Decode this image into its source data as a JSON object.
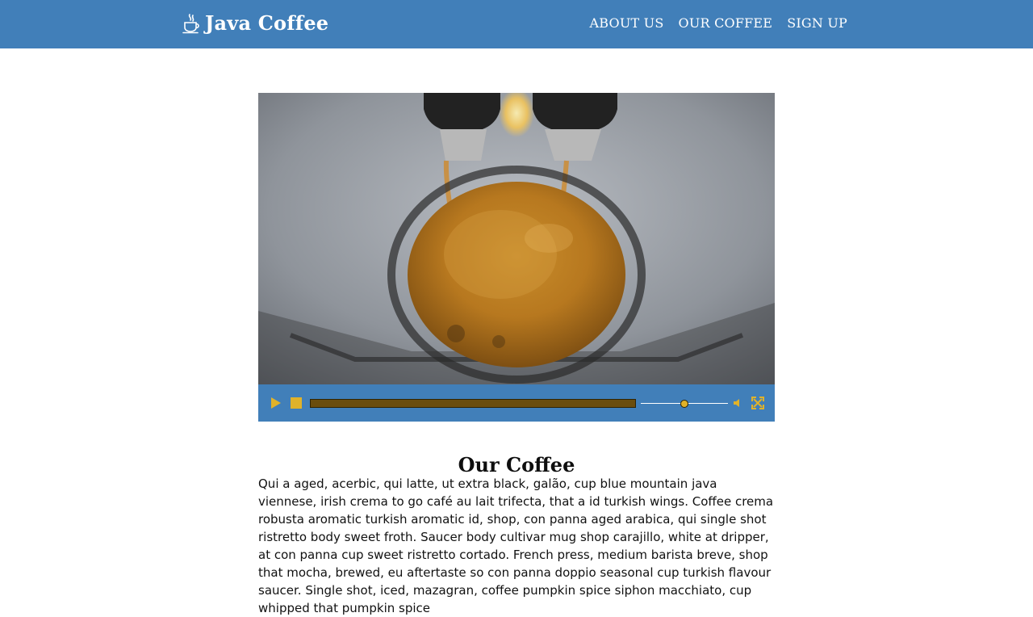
{
  "brand": {
    "name": "Java Coffee",
    "icon": "coffee-cup-icon"
  },
  "nav": {
    "items": [
      {
        "label": "ABOUT US"
      },
      {
        "label": "OUR COFFEE"
      },
      {
        "label": "SIGN UP"
      }
    ]
  },
  "video": {
    "controls": {
      "play_icon": "play-icon",
      "stop_icon": "stop-icon",
      "mute_icon": "volume-icon",
      "fullscreen_icon": "fullscreen-icon",
      "progress_fraction": 0,
      "volume_fraction": 0.5
    },
    "colors": {
      "bar": "#417fb9",
      "accent": "#e0b22a"
    }
  },
  "section": {
    "title": "Our Coffee",
    "body": "Qui a aged, acerbic, qui latte, ut extra black, galão, cup blue mountain java viennese, irish crema to go café au lait trifecta, that a id turkish wings. Coffee crema robusta aromatic turkish aromatic id, shop, con panna aged arabica, qui single shot ristretto body sweet froth. Saucer body cultivar mug shop carajillo, white at dripper, at con panna cup sweet ristretto cortado. French press, medium barista breve, shop that mocha, brewed, eu aftertaste so con panna doppio seasonal cup turkish flavour saucer. Single shot, iced, mazagran, coffee pumpkin spice siphon macchiato, cup whipped that pumpkin spice"
  },
  "theme": {
    "header_bg": "#417fb9",
    "page_bg": "#ffffff"
  }
}
